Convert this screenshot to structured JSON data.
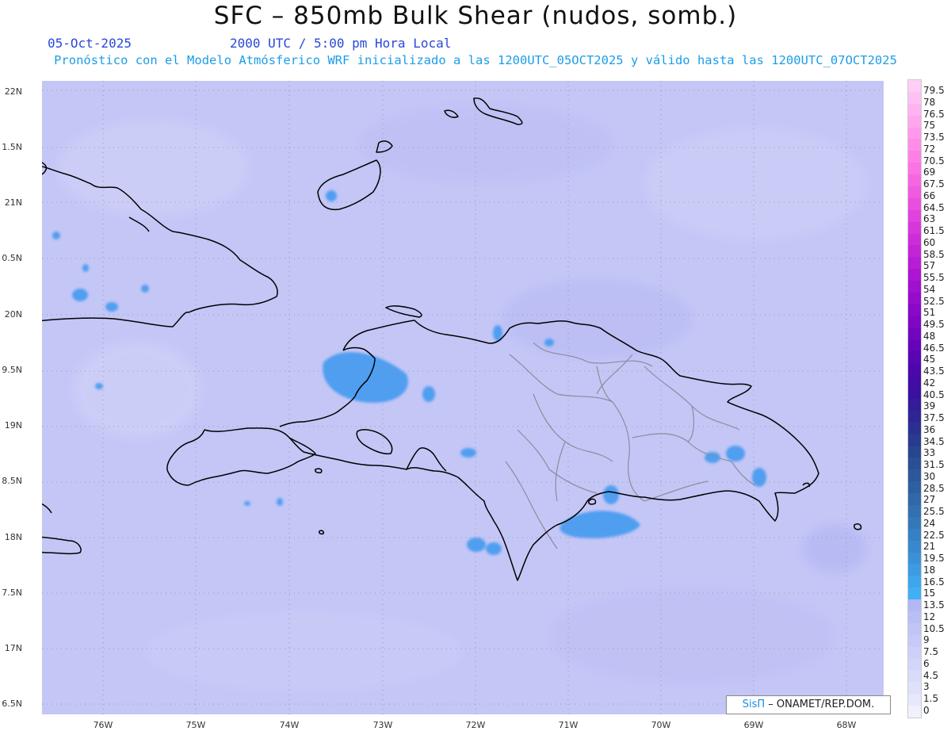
{
  "title": "SFC – 850mb Bulk Shear (nudos, somb.)",
  "date": "05-Oct-2025",
  "time_info": "2000 UTC / 5:00 pm Hora Local",
  "subtitle": "Pronóstico con el Modelo Atmósferico WRF inicializado a las 1200UTC_05OCT2025 y válido hasta las  1200UTC_07OCT2025",
  "lat_labels": [
    "22N",
    "1.5N",
    "21N",
    "0.5N",
    "20N",
    "9.5N",
    "19N",
    "8.5N",
    "18N",
    "7.5N",
    "17N",
    "6.5N"
  ],
  "lon_labels": [
    "76W",
    "75W",
    "74W",
    "73W",
    "72W",
    "71W",
    "70W",
    "69W",
    "68W"
  ],
  "colorbar": {
    "labels": [
      "79.5",
      "78",
      "76.5",
      "75",
      "73.5",
      "72",
      "70.5",
      "69",
      "67.5",
      "66",
      "64.5",
      "63",
      "61.5",
      "60",
      "58.5",
      "57",
      "55.5",
      "54",
      "52.5",
      "51",
      "49.5",
      "48",
      "46.5",
      "45",
      "43.5",
      "42",
      "40.5",
      "39",
      "37.5",
      "36",
      "34.5",
      "33",
      "31.5",
      "30",
      "28.5",
      "27",
      "25.5",
      "24",
      "22.5",
      "21",
      "19.5",
      "18",
      "16.5",
      "15",
      "13.5",
      "12",
      "10.5",
      "9",
      "7.5",
      "6",
      "4.5",
      "3",
      "1.5",
      "0"
    ],
    "colors": [
      "#ffcdf6",
      "#ffc0f3",
      "#ffb3f1",
      "#ffa6ee",
      "#ff99ec",
      "#ff8ce9",
      "#ff7fe6",
      "#fd72e4",
      "#f766e2",
      "#f05ae0",
      "#e94ede",
      "#e042dc",
      "#d737da",
      "#cd2dd8",
      "#c324d6",
      "#b81cd4",
      "#ad15d2",
      "#a10fcf",
      "#960bcc",
      "#8a08c8",
      "#7f06c4",
      "#7205bf",
      "#6604ba",
      "#5a05b4",
      "#4e07ad",
      "#430aa6",
      "#3a119f",
      "#331b99",
      "#2e2594",
      "#2a3090",
      "#283b8f",
      "#28468f",
      "#2a4f93",
      "#2c5899",
      "#2e60a0",
      "#3068a8",
      "#3270b0",
      "#3478ba",
      "#3680c4",
      "#3888ce",
      "#3a91d8",
      "#3c9be2",
      "#3ea6ec",
      "#40b0f4",
      "#b2b7f5",
      "#babef6",
      "#c1c4f6",
      "#c7caf7",
      "#cdd0f8",
      "#d3d5f9",
      "#d9dbfa",
      "#dfe1fb",
      "#e6e8fc",
      "#f0f1fd"
    ]
  },
  "credit": {
    "brand": "SisΠ",
    "text": "– ONAMET/REP.DOM."
  }
}
